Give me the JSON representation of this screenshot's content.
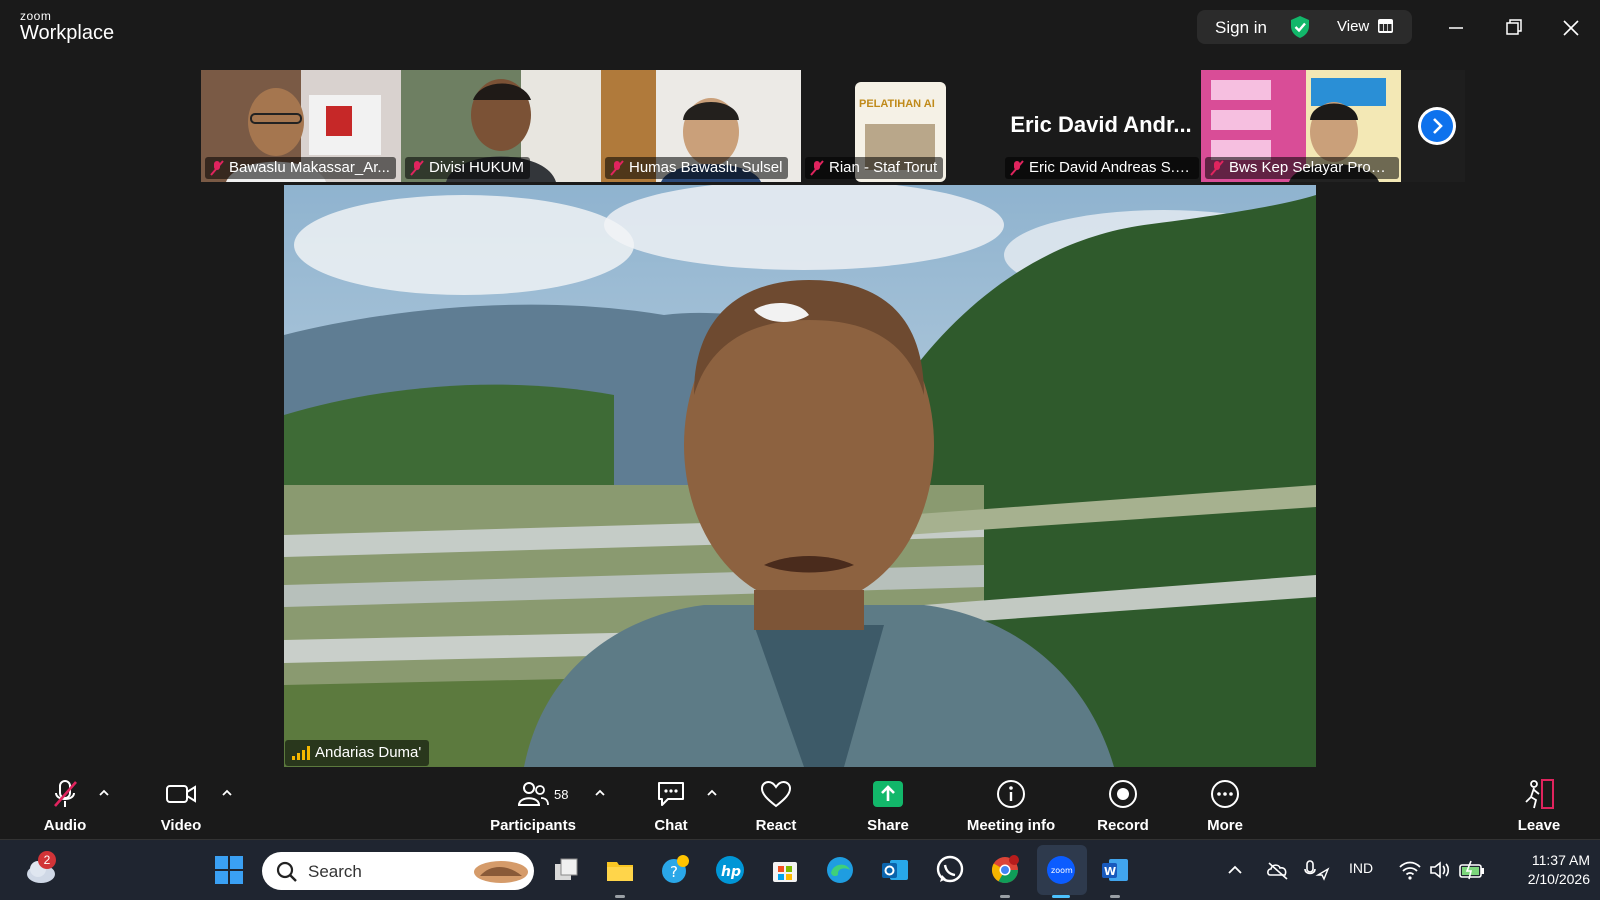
{
  "app": {
    "brand_small": "zoom",
    "brand_large": "Workplace"
  },
  "header": {
    "sign_in": "Sign in",
    "view_label": "View"
  },
  "thumbnails": [
    {
      "name": "Bawaslu Makassar_Ar...",
      "muted": true
    },
    {
      "name": "Divisi HUKUM",
      "muted": true
    },
    {
      "name": "Humas Bawaslu Sulsel",
      "muted": true
    },
    {
      "name": "Rian - Staf Torut",
      "muted": true,
      "slide_text": "PELATIHAN AI"
    },
    {
      "name": "Eric David Andreas S.H...",
      "muted": true,
      "display_name": "Eric David Andr..."
    },
    {
      "name": "Bws Kep Selayar Prov ...",
      "muted": true
    }
  ],
  "main_video": {
    "speaker_name": "Andarias Duma'"
  },
  "toolbar": {
    "audio": "Audio",
    "video": "Video",
    "participants": "Participants",
    "participant_count": "58",
    "chat": "Chat",
    "react": "React",
    "share": "Share",
    "meeting_info": "Meeting info",
    "record": "Record",
    "more": "More",
    "leave": "Leave"
  },
  "taskbar": {
    "search_placeholder": "Search",
    "weather_badge": "2",
    "language": "IND",
    "time": "11:37 AM",
    "date": "2/10/2026"
  },
  "colors": {
    "accent_blue": "#0e72ed",
    "share_green": "#12b76a",
    "mute_red": "#e0245e"
  }
}
